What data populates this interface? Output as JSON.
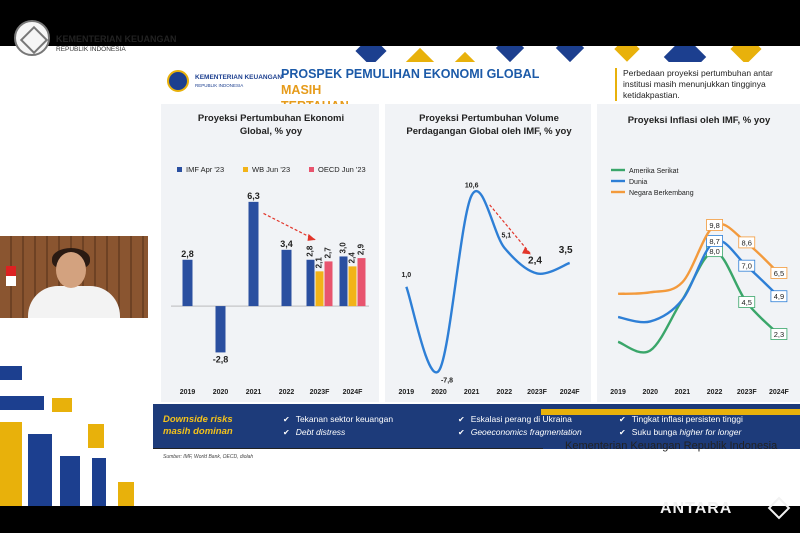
{
  "page": {
    "ministry_name": "KEMENTERIAN KEUANGAN",
    "ministry_sub": "REPUBLIK INDONESIA",
    "footer_text": "Kementerian Keuangan Republik Indonesia",
    "watermark": "ANTARA"
  },
  "slide": {
    "ministry_name": "KEMENTERIAN KEUANGAN",
    "ministry_sub": "REPUBLIK INDONESIA",
    "title_main": "PROSPEK PEMULIHAN EKONOMI GLOBAL ",
    "title_highlight_1": "MASIH",
    "title_highlight_2": "TERTAHAN",
    "note": "Perbedaan proyeksi pertumbuhan antar institusi masih menunjukkan tingginya ketidakpastian.",
    "source": "Sumber: IMF, World Bank, OECD, diolah",
    "risk_title_1": "Downside risks",
    "risk_title_2": "masih dominan",
    "risks": [
      {
        "text": "Tekanan sektor keuangan",
        "italic": false
      },
      {
        "text": "Debt distress",
        "italic": true
      },
      {
        "text": "Eskalasi perang di Ukraina",
        "italic": false
      },
      {
        "text": "Geoeconomics fragmentation",
        "italic": true
      },
      {
        "text": "Tingkat inflasi persisten tinggi",
        "italic": false
      },
      {
        "text_pre": "Suku bunga ",
        "text_it": "higher for longer",
        "italic": "mixed"
      }
    ]
  },
  "colors": {
    "navy": "#1c3f8f",
    "imf_blue": "#2a4fa0",
    "wb_yellow": "#f2b318",
    "oecd_pink": "#e8546e",
    "accent_blue": "#2e7fd6",
    "orange": "#f39a3c",
    "green": "#3aa66a",
    "red_arrow": "#e2362b"
  },
  "chart_data": [
    {
      "type": "bar",
      "title_1": "Proyeksi Pertumbuhan Ekonomi",
      "title_2": "Global, % yoy",
      "categories": [
        "2019",
        "2020",
        "2021",
        "2022",
        "2023F",
        "2024F"
      ],
      "legend": [
        "IMF Apr '23",
        "WB Jun '23",
        "OECD Jun '23"
      ],
      "series": [
        {
          "name": "IMF Apr '23",
          "values": [
            2.8,
            -2.8,
            6.3,
            3.4,
            2.8,
            3.0
          ],
          "labels": [
            "2,8",
            "-2,8",
            "6,3",
            "3,4",
            "2,8",
            "3,0"
          ]
        },
        {
          "name": "WB Jun '23",
          "values": [
            null,
            null,
            null,
            null,
            2.1,
            2.4
          ],
          "labels": [
            "",
            "",
            "",
            "",
            "2,1",
            "2,4"
          ]
        },
        {
          "name": "OECD Jun '23",
          "values": [
            null,
            null,
            null,
            null,
            2.7,
            2.9
          ],
          "labels": [
            "",
            "",
            "",
            "",
            "2,7",
            "2,9"
          ]
        }
      ],
      "ylim": [
        -3.5,
        7.5
      ]
    },
    {
      "type": "line",
      "title_1": "Proyeksi Pertumbuhan Volume",
      "title_2": "Perdagangan Global oleh IMF, % yoy",
      "categories": [
        "2019",
        "2020",
        "2021",
        "2022",
        "2023F",
        "2024F"
      ],
      "values": [
        1.0,
        -7.8,
        10.6,
        5.1,
        2.4,
        3.5
      ],
      "labels": [
        "1,0",
        "-7,8",
        "10,6",
        "5,1",
        "2,4",
        "3,5"
      ],
      "ylim": [
        -9,
        12
      ]
    },
    {
      "type": "line",
      "title": "Proyeksi Inflasi oleh IMF, % yoy",
      "categories": [
        "2019",
        "2020",
        "2021",
        "2022",
        "2023F",
        "2024F"
      ],
      "series": [
        {
          "name": "Amerika Serikat",
          "values": [
            1.8,
            1.2,
            4.7,
            8.0,
            4.5,
            2.3
          ],
          "labels": [
            "",
            "",
            "",
            "8,0",
            "4,5",
            "2,3"
          ]
        },
        {
          "name": "Dunia",
          "values": [
            3.5,
            3.2,
            4.7,
            8.7,
            7.0,
            4.9
          ],
          "labels": [
            "",
            "",
            "",
            "8,7",
            "7,0",
            "4,9"
          ]
        },
        {
          "name": "Negara Berkembang",
          "values": [
            5.1,
            5.2,
            5.9,
            9.8,
            8.6,
            6.5
          ],
          "labels": [
            "",
            "",
            "",
            "9,8",
            "8,6",
            "6,5"
          ]
        }
      ],
      "ylim": [
        0,
        11
      ]
    }
  ]
}
